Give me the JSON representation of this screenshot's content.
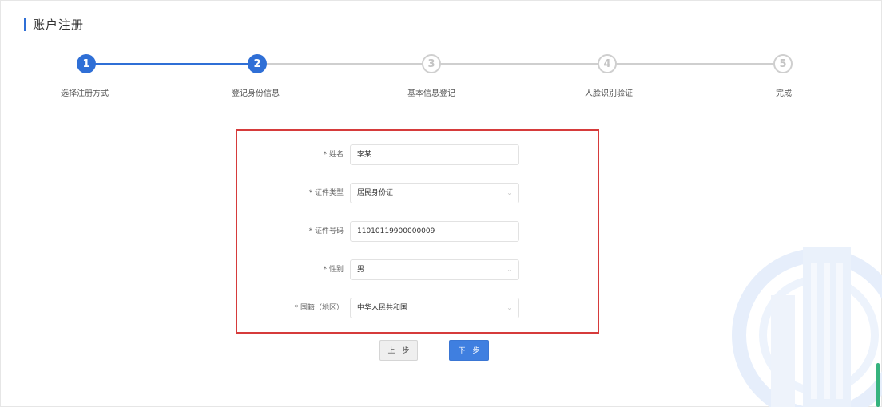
{
  "page": {
    "title": "账户注册"
  },
  "steps": [
    {
      "number": "1",
      "label": "选择注册方式",
      "state": "done"
    },
    {
      "number": "2",
      "label": "登记身份信息",
      "state": "done"
    },
    {
      "number": "3",
      "label": "基本信息登记",
      "state": "todo"
    },
    {
      "number": "4",
      "label": "人脸识别验证",
      "state": "todo"
    },
    {
      "number": "5",
      "label": "完成",
      "state": "todo"
    }
  ],
  "form": {
    "name": {
      "label": "* 姓名",
      "value": "李某"
    },
    "id_type": {
      "label": "* 证件类型",
      "value": "居民身份证"
    },
    "id_number": {
      "label": "* 证件号码",
      "value": "11010119900000009"
    },
    "gender": {
      "label": "* 性别",
      "value": "男"
    },
    "country": {
      "label": "* 国籍（地区）",
      "value": "中华人民共和国"
    }
  },
  "buttons": {
    "prev": "上一步",
    "next": "下一步"
  },
  "colors": {
    "primary": "#2f6fd6",
    "highlight_border": "#d63b3b",
    "inactive": "#cfcfcf"
  }
}
